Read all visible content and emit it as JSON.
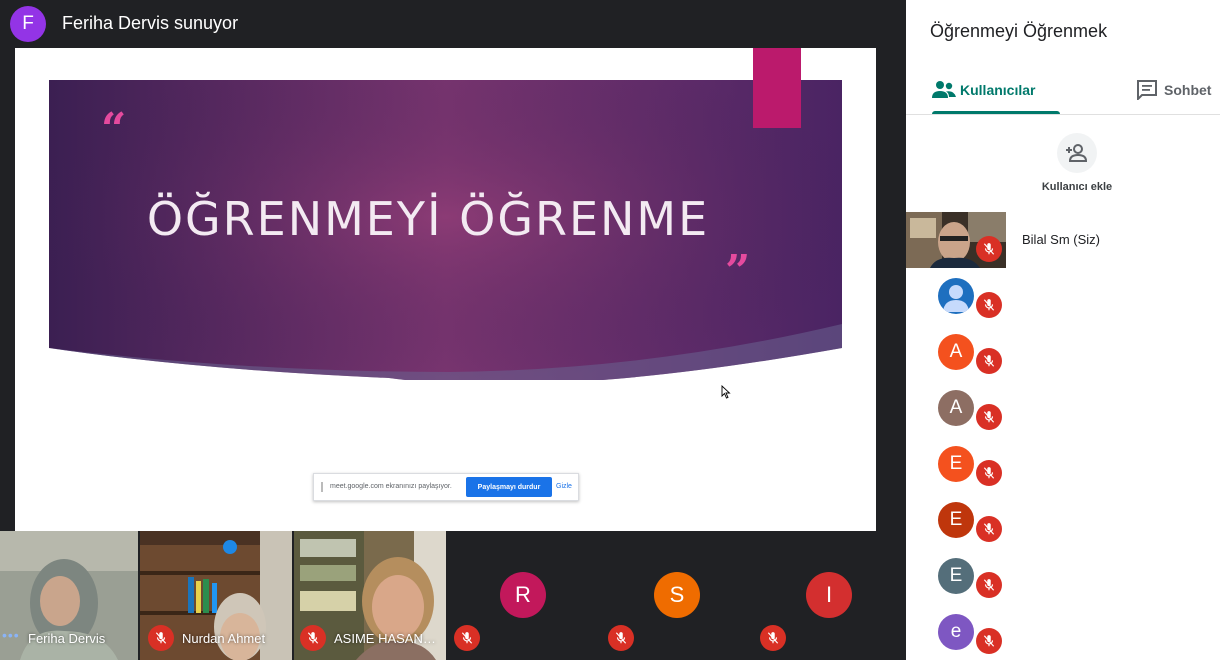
{
  "presenter": {
    "initial": "F",
    "title": "Feriha Dervis sunuyor",
    "avatar_color": "#9334e6"
  },
  "slide": {
    "title": "ÖĞRENMEYİ ÖĞRENME",
    "quote_open": "“",
    "quote_close": "”",
    "gradient_colors": [
      "#3b1f52",
      "#7a3570",
      "#4a2463"
    ],
    "accent_color": "#bb1a6c"
  },
  "share_bar": {
    "text": "meet.google.com ekranınızı paylaşıyor.",
    "stop_label": "Paylaşmayı durdur",
    "hide_label": "Gizle"
  },
  "filmstrip": [
    {
      "name": "Feriha Dervis",
      "type": "video",
      "muted": false,
      "speaking": true
    },
    {
      "name": "Nurdan Ahmet",
      "type": "video",
      "muted": true
    },
    {
      "name": "ASIME HASAN…",
      "type": "video",
      "muted": true
    },
    {
      "initial": "R",
      "type": "avatar",
      "color": "#c2185b",
      "muted": true
    },
    {
      "initial": "S",
      "type": "avatar",
      "color": "#ef6c00",
      "muted": true
    },
    {
      "initial": "I",
      "type": "avatar",
      "color": "#d32f2f",
      "muted": true
    }
  ],
  "panel": {
    "title": "Öğrenmeyi Öğrenmek",
    "tabs": [
      {
        "label": "Kullanıcılar",
        "icon": "people-icon",
        "active": true
      },
      {
        "label": "Sohbet",
        "icon": "chat-icon",
        "active": false
      }
    ],
    "add_user_label": "Kullanıcı ekle",
    "participants": [
      {
        "name": "Bilal Sm (Siz)",
        "type": "video"
      },
      {
        "initial": "",
        "type": "profile",
        "color": "#1e6fbf"
      },
      {
        "initial": "A",
        "color": "#f4511e"
      },
      {
        "initial": "A",
        "color": "#8d6e63"
      },
      {
        "initial": "E",
        "color": "#f4511e"
      },
      {
        "initial": "E",
        "color": "#bf360c"
      },
      {
        "initial": "E",
        "color": "#546e7a"
      },
      {
        "initial": "e",
        "color": "#7e57c2"
      }
    ]
  }
}
